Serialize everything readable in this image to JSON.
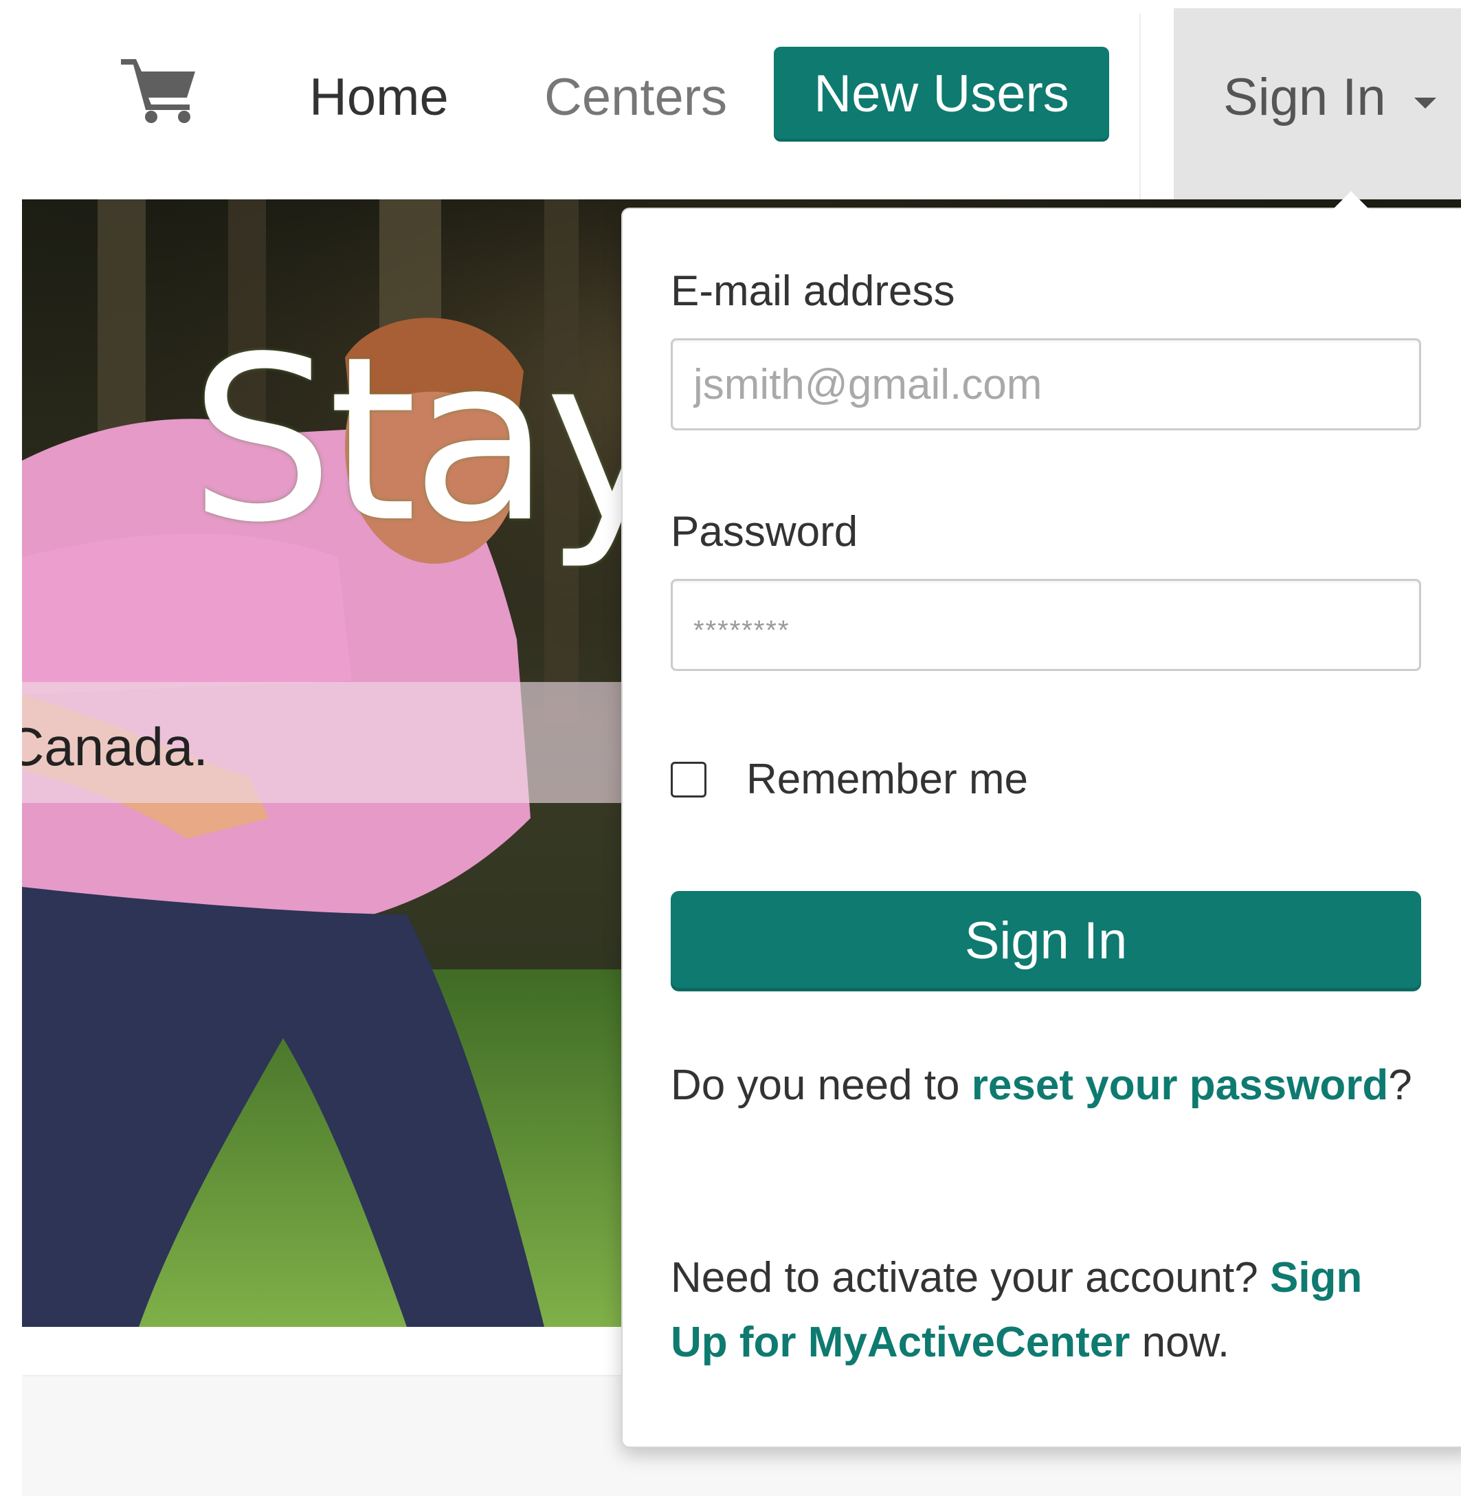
{
  "nav": {
    "cart_icon": "shopping-cart-icon",
    "home": "Home",
    "centers": "Centers",
    "new_users": "New Users",
    "sign_in": "Sign In",
    "caret_icon": "caret-down-icon"
  },
  "hero": {
    "title": "Stay",
    "band_text": "Canada."
  },
  "signin_form": {
    "email_label": "E-mail address",
    "email_placeholder": "jsmith@gmail.com",
    "password_label": "Password",
    "password_placeholder": "********",
    "remember_label": "Remember me",
    "remember_checked": false,
    "submit": "Sign In",
    "reset_prefix": "Do you need to ",
    "reset_link": "reset your password",
    "reset_suffix": "?",
    "activate_prefix": "Need to activate your account? ",
    "activate_link": "Sign Up for MyActiveCenter",
    "activate_suffix": " now."
  },
  "colors": {
    "brand": "#0e7a70",
    "toggle_bg": "#e4e4e4"
  }
}
